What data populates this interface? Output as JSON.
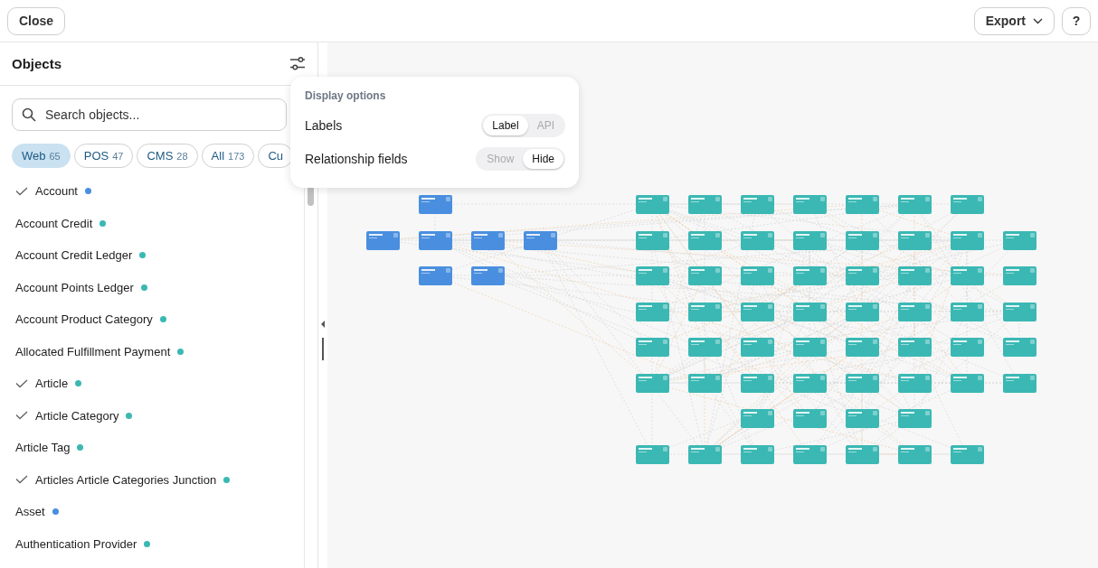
{
  "toolbar": {
    "close": "Close",
    "export": "Export",
    "help": "?"
  },
  "sidebar": {
    "title": "Objects",
    "search": {
      "placeholder": "Search objects..."
    },
    "filters": [
      {
        "label": "Web",
        "count": "65",
        "selected": true
      },
      {
        "label": "POS",
        "count": "47",
        "selected": false
      },
      {
        "label": "CMS",
        "count": "28",
        "selected": false
      },
      {
        "label": "All",
        "count": "173",
        "selected": false
      },
      {
        "label": "Cu",
        "selected": false
      }
    ],
    "items": [
      {
        "label": "Account",
        "checked": true,
        "color": "#4a8fdf"
      },
      {
        "label": "Account Credit",
        "checked": false,
        "color": "#3bb8b4"
      },
      {
        "label": "Account Credit Ledger",
        "checked": false,
        "color": "#3bb8b4"
      },
      {
        "label": "Account Points Ledger",
        "checked": false,
        "color": "#3bb8b4"
      },
      {
        "label": "Account Product Category",
        "checked": false,
        "color": "#3bb8b4"
      },
      {
        "label": "Allocated Fulfillment Payment",
        "checked": false,
        "color": "#3bb8b4"
      },
      {
        "label": "Article",
        "checked": true,
        "color": "#3bb8b4"
      },
      {
        "label": "Article Category",
        "checked": true,
        "color": "#3bb8b4"
      },
      {
        "label": "Article Tag",
        "checked": false,
        "color": "#3bb8b4"
      },
      {
        "label": "Articles Article Categories Junction",
        "checked": true,
        "color": "#3bb8b4"
      },
      {
        "label": "Asset",
        "checked": false,
        "color": "#4a8fdf"
      },
      {
        "label": "Authentication Provider",
        "checked": false,
        "color": "#3bb8b4"
      }
    ]
  },
  "display_options": {
    "title": "Display options",
    "rows": [
      {
        "label": "Labels",
        "options": [
          {
            "label": "Label",
            "selected": true
          },
          {
            "label": "API",
            "selected": false
          }
        ]
      },
      {
        "label": "Relationship fields",
        "options": [
          {
            "label": "Show",
            "selected": false
          },
          {
            "label": "Hide",
            "selected": true
          }
        ]
      }
    ]
  }
}
